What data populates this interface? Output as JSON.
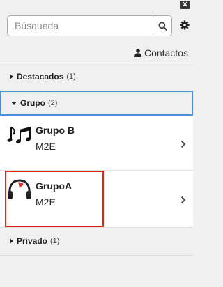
{
  "search": {
    "placeholder": "Búsqueda"
  },
  "contacts": {
    "label": "Contactos"
  },
  "sections": {
    "featured": {
      "title": "Destacados",
      "count": "(1)"
    },
    "group": {
      "title": "Grupo",
      "count": "(2)"
    },
    "private": {
      "title": "Privado",
      "count": "(1)"
    }
  },
  "groups": [
    {
      "name": "Grupo B",
      "subtitle": "M2E",
      "icon": "music-notes-icon"
    },
    {
      "name": "GrupoA",
      "subtitle": "M2E",
      "icon": "headphones-icon"
    }
  ],
  "colors": {
    "highlight": "#e2231a",
    "active_border": "#4a90d9"
  }
}
